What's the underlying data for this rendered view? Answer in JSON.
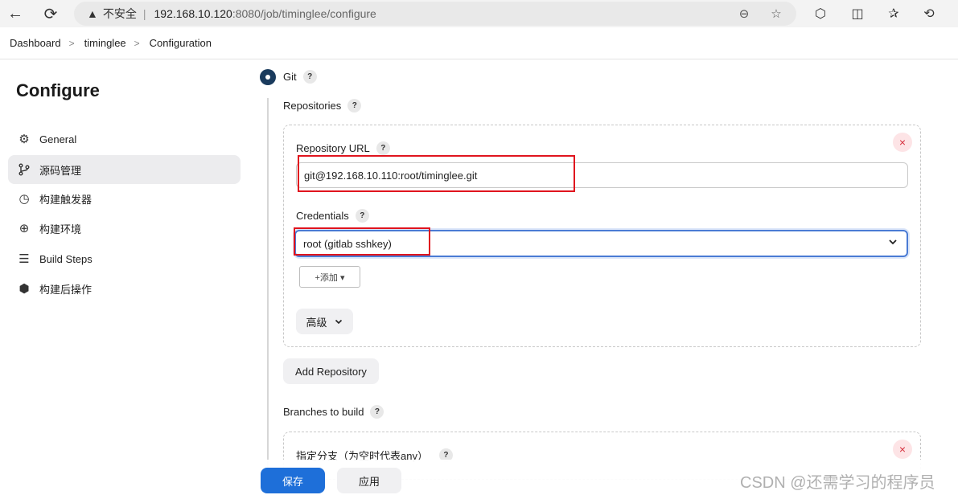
{
  "browser": {
    "insecure_label": "不安全",
    "url_host": "192.168.10.120",
    "url_path": ":8080/job/timinglee/configure",
    "icons": [
      "back-icon",
      "reload-icon",
      "warning-icon",
      "zoom-icon",
      "star-icon",
      "extension-icon",
      "split-view-icon",
      "favorites-icon",
      "history-icon"
    ]
  },
  "breadcrumb": {
    "items": [
      "Dashboard",
      "timinglee",
      "Configuration"
    ],
    "separator": ">"
  },
  "sidebar": {
    "title": "Configure",
    "items": [
      {
        "label": "General",
        "icon": "gear-icon"
      },
      {
        "label": "源码管理",
        "icon": "branch-icon",
        "active": true
      },
      {
        "label": "构建触发器",
        "icon": "clock-icon"
      },
      {
        "label": "构建环境",
        "icon": "globe-icon"
      },
      {
        "label": "Build Steps",
        "icon": "list-icon"
      },
      {
        "label": "构建后操作",
        "icon": "cube-icon"
      }
    ]
  },
  "scm": {
    "option_label": "Git",
    "help": "?",
    "repositories_label": "Repositories",
    "repo_url_label": "Repository URL",
    "repo_url_value": "git@192.168.10.110:root/timinglee.git",
    "credentials_label": "Credentials",
    "credentials_value": "root (gitlab sshkey)",
    "add_button": "+添加 ▾",
    "advanced_button": "高级",
    "add_repository_button": "Add Repository",
    "branches_label": "Branches to build",
    "branch_specifier_label": "指定分支（为空时代表any）",
    "close_glyph": "×"
  },
  "footer": {
    "save": "保存",
    "apply": "应用"
  },
  "watermark": "CSDN @还需学习的程序员",
  "colors": {
    "primary": "#1e6fd9",
    "highlight": "#e0141e",
    "radio": "#1a3b5d"
  }
}
